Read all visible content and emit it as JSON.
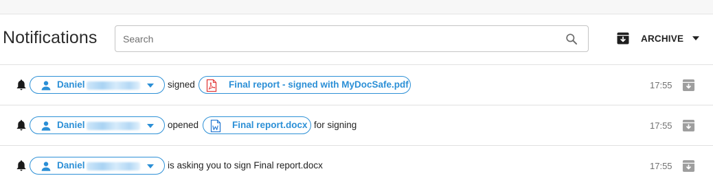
{
  "header": {
    "title": "Notifications",
    "search_placeholder": "Search",
    "search_value": "",
    "archive_label": "ARCHIVE"
  },
  "notifications": [
    {
      "user_name": "Daniel",
      "action": "signed",
      "file_name": "Final report - signed with MyDocSafe.pdf",
      "file_type": "pdf",
      "suffix": "",
      "time": "17:55"
    },
    {
      "user_name": "Daniel",
      "action": "opened",
      "file_name": "Final report.docx",
      "file_type": "docx",
      "suffix": "for signing",
      "time": "17:55"
    },
    {
      "user_name": "Daniel",
      "action": "is asking you to sign Final report.docx",
      "file_name": "",
      "file_type": "",
      "suffix": "",
      "time": "17:55"
    }
  ],
  "colors": {
    "accent": "#2b8fd6",
    "pdf_red": "#e23b3b",
    "doc_blue": "#2b7cd3",
    "icon_grey": "#9e9e9e"
  },
  "icons": {
    "search": "search-icon",
    "archive": "archive-box-icon",
    "bell": "bell-icon",
    "user": "person-icon",
    "pdf": "pdf-file-icon",
    "word": "word-file-icon",
    "row_archive": "archive-icon"
  }
}
